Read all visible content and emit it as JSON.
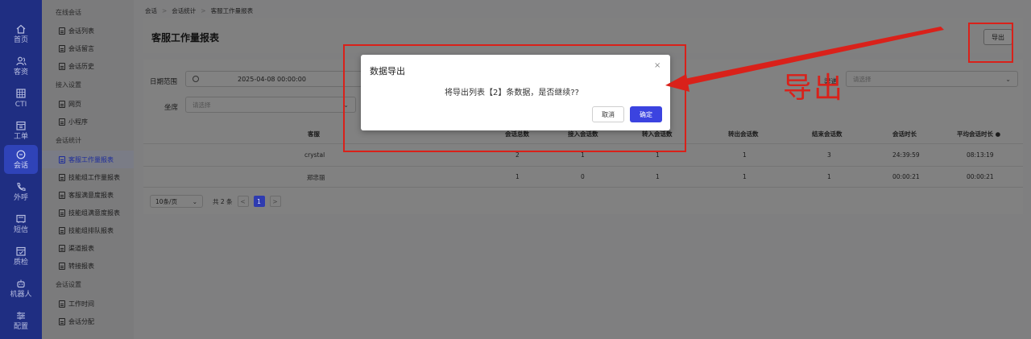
{
  "rail": {
    "items": [
      {
        "label": "首页",
        "icon": "home-icon"
      },
      {
        "label": "客资",
        "icon": "users-icon"
      },
      {
        "label": "CTI",
        "icon": "grid-icon"
      },
      {
        "label": "工单",
        "icon": "calendar-icon"
      },
      {
        "label": "会话",
        "icon": "chat-icon",
        "active": true
      },
      {
        "label": "外呼",
        "icon": "phone-icon"
      },
      {
        "label": "短信",
        "icon": "message-icon"
      },
      {
        "label": "质检",
        "icon": "inspect-icon"
      },
      {
        "label": "机器人",
        "icon": "robot-icon"
      },
      {
        "label": "配置",
        "icon": "settings-icon"
      }
    ]
  },
  "menu": {
    "items": [
      {
        "type": "group",
        "label": "在线会话"
      },
      {
        "type": "leaf",
        "label": "会话列表"
      },
      {
        "type": "leaf",
        "label": "会话留言"
      },
      {
        "type": "leaf",
        "label": "会话历史"
      },
      {
        "type": "group",
        "label": "接入设置"
      },
      {
        "type": "leaf",
        "label": "网页"
      },
      {
        "type": "leaf",
        "label": "小程序"
      },
      {
        "type": "group",
        "label": "会话统计"
      },
      {
        "type": "leaf",
        "label": "客服工作量报表",
        "active": true
      },
      {
        "type": "leaf",
        "label": "技能组工作量报表"
      },
      {
        "type": "leaf",
        "label": "客服满意度报表"
      },
      {
        "type": "leaf",
        "label": "技能组满意度报表"
      },
      {
        "type": "leaf",
        "label": "技能组排队报表"
      },
      {
        "type": "leaf",
        "label": "渠道报表"
      },
      {
        "type": "leaf",
        "label": "转接报表"
      },
      {
        "type": "group",
        "label": "会话设置"
      },
      {
        "type": "leaf",
        "label": "工作时间"
      },
      {
        "type": "leaf",
        "label": "会话分配"
      }
    ]
  },
  "breadcrumb": {
    "items": [
      "会话",
      "会话统计",
      "客服工作量报表"
    ],
    "separator": ">"
  },
  "page": {
    "title": "客服工作量报表",
    "export_label": "导出"
  },
  "filters": {
    "date_label": "日期范围",
    "date_value": "2025-04-08 00:00:00",
    "seat_label": "坐席",
    "seat_placeholder": "请选择",
    "channel_label": "渠道",
    "channel_placeholder": "请选择"
  },
  "table": {
    "headers": [
      "客服",
      "会话总数",
      "接入会话数",
      "转入会话数",
      "转出会话数",
      "结束会话数",
      "会话时长",
      "平均会话时长"
    ],
    "rows": [
      [
        "crystal",
        "2",
        "1",
        "1",
        "1",
        "3",
        "24:39:59",
        "08:13:19"
      ],
      [
        "郑忠丽",
        "1",
        "0",
        "1",
        "1",
        "1",
        "00:00:21",
        "00:00:21"
      ]
    ]
  },
  "pager": {
    "page_size": "10条/页",
    "total": "共 2 条",
    "prev": "<",
    "current": "1",
    "next": ">"
  },
  "modal": {
    "title": "数据导出",
    "close": "×",
    "message": "将导出列表【2】条数据，是否继续??",
    "cancel": "取消",
    "confirm": "确定"
  },
  "annotation": {
    "text": "导出",
    "color": "#d9211a"
  },
  "colors": {
    "rail_bg": "#1f2e82",
    "primary": "#3b43e0",
    "annotation": "#d9211a"
  }
}
